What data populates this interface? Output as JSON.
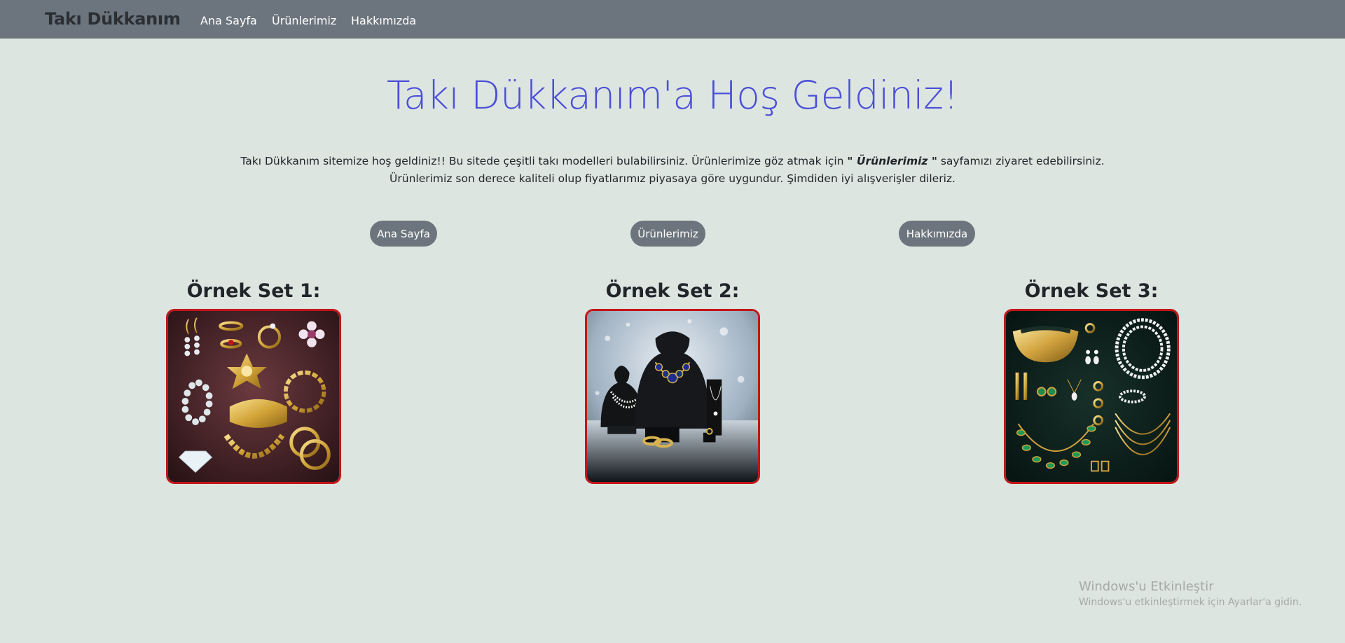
{
  "navbar": {
    "brand": "Takı Dükkanım",
    "links": [
      "Ana Sayfa",
      "Ürünlerimiz",
      "Hakkımızda"
    ]
  },
  "hero": {
    "title": "Takı Dükkanım'a Hoş Geldiniz!",
    "intro_line1_start": "Takı Dükkanım sitemize hoş geldiniz!! Bu sitede çeşitli takı modelleri bulabilirsiniz. Ürünlerimize göz atmak için ",
    "intro_emphasis": "\" Ürünlerimiz \"",
    "intro_line1_end": " sayfamızı ziyaret edebilirsiniz.",
    "intro_line2": "Ürünlerimiz son derece kaliteli olup fiyatlarımız piyasaya göre uygundur. Şimdiden iyi alışverişler dileriz."
  },
  "buttons": [
    "Ana Sayfa",
    "Ürünlerimiz",
    "Hakkımızda"
  ],
  "sets": [
    {
      "title": "Örnek Set 1:"
    },
    {
      "title": "Örnek Set 2:"
    },
    {
      "title": "Örnek Set 3:"
    }
  ],
  "watermark": {
    "title": "Windows'u Etkinleştir",
    "subtitle": "Windows'u etkinleştirmek için Ayarlar'a gidin."
  },
  "colors": {
    "navbar_bg": "#6c757d",
    "page_bg": "#dde5e1",
    "hero_title": "#4b4fd8",
    "image_border": "#c31618"
  }
}
